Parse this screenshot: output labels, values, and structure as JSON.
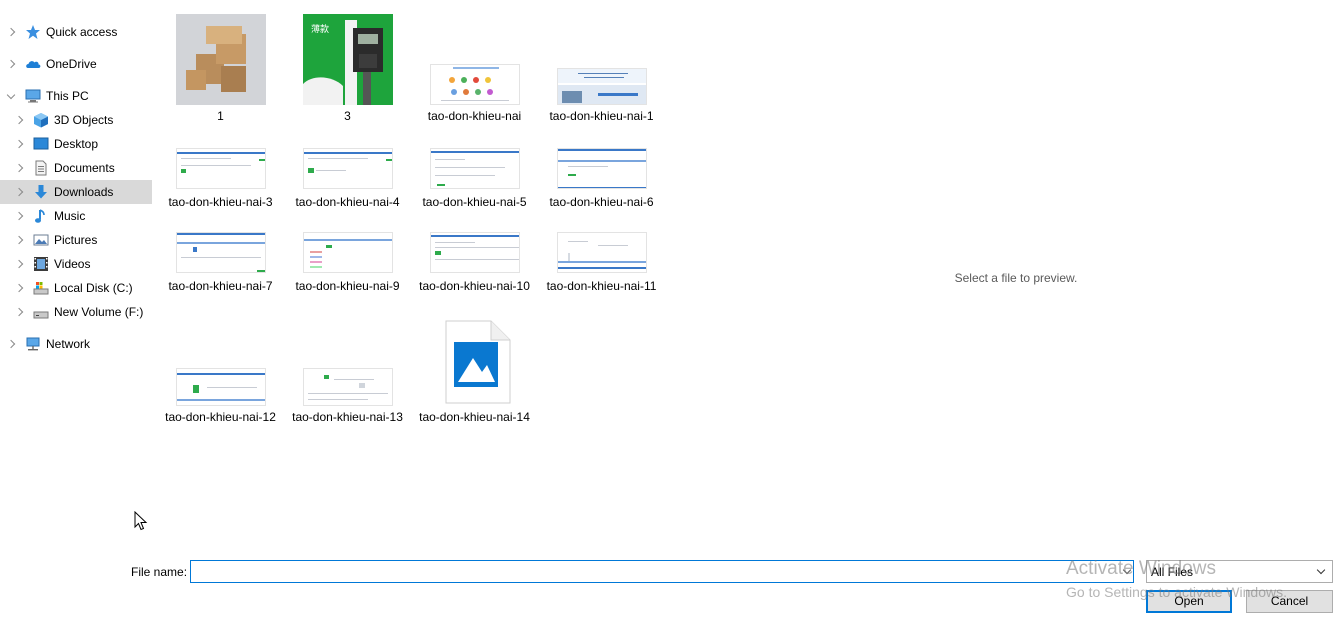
{
  "nav": {
    "items": [
      {
        "label": "Quick access",
        "icon": "quick-access-star-icon"
      },
      {
        "label": "OneDrive",
        "icon": "onedrive-cloud-icon"
      },
      {
        "label": "This PC",
        "icon": "this-pc-icon"
      },
      {
        "label": "3D Objects",
        "icon": "3d-objects-icon"
      },
      {
        "label": "Desktop",
        "icon": "desktop-icon"
      },
      {
        "label": "Documents",
        "icon": "documents-icon"
      },
      {
        "label": "Downloads",
        "icon": "downloads-icon",
        "selected": true
      },
      {
        "label": "Music",
        "icon": "music-icon"
      },
      {
        "label": "Pictures",
        "icon": "pictures-icon"
      },
      {
        "label": "Videos",
        "icon": "videos-icon"
      },
      {
        "label": "Local Disk (C:)",
        "icon": "local-disk-icon"
      },
      {
        "label": "New Volume (F:)",
        "icon": "drive-icon"
      },
      {
        "label": "Network",
        "icon": "network-icon"
      }
    ]
  },
  "files": [
    {
      "name": "1",
      "thumb": "photo-boxes"
    },
    {
      "name": "3",
      "thumb": "photo-caliper",
      "overlay_text": "薄款"
    },
    {
      "name": "tao-don-khieu-nai",
      "thumb": "screenshot"
    },
    {
      "name": "tao-don-khieu-nai-1",
      "thumb": "screenshot"
    },
    {
      "name": "tao-don-khieu-nai-3",
      "thumb": "screenshot"
    },
    {
      "name": "tao-don-khieu-nai-4",
      "thumb": "screenshot"
    },
    {
      "name": "tao-don-khieu-nai-5",
      "thumb": "screenshot"
    },
    {
      "name": "tao-don-khieu-nai-6",
      "thumb": "screenshot"
    },
    {
      "name": "tao-don-khieu-nai-7",
      "thumb": "screenshot"
    },
    {
      "name": "tao-don-khieu-nai-9",
      "thumb": "screenshot"
    },
    {
      "name": "tao-don-khieu-nai-10",
      "thumb": "screenshot"
    },
    {
      "name": "tao-don-khieu-nai-11",
      "thumb": "screenshot"
    },
    {
      "name": "tao-don-khieu-nai-12",
      "thumb": "screenshot"
    },
    {
      "name": "tao-don-khieu-nai-13",
      "thumb": "screenshot"
    },
    {
      "name": "tao-don-khieu-nai-14",
      "thumb": "image-file-icon"
    }
  ],
  "preview": {
    "message": "Select a file to preview."
  },
  "footer": {
    "filename_label": "File name:",
    "filename_value": "",
    "filter_value": "All Files",
    "open_label": "Open",
    "cancel_label": "Cancel"
  },
  "watermark": {
    "line1": "Activate Windows",
    "line2": "Go to Settings to activate Windows."
  },
  "colors": {
    "accent": "#0078d7",
    "selected_bg": "#d9d9d9",
    "folder_blue": "#2b88d8"
  }
}
